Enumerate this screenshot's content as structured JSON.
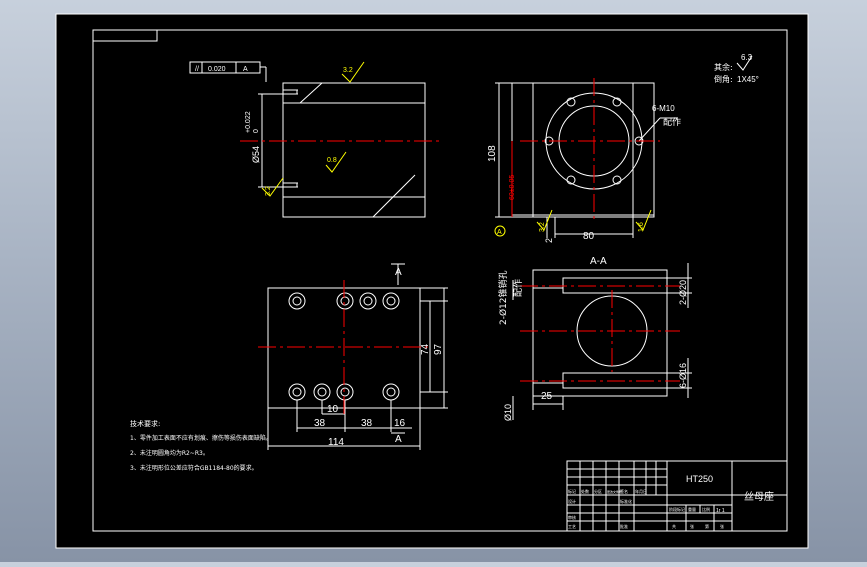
{
  "drawing": {
    "title_block": {
      "material": "HT250",
      "part_name": "丝母座",
      "sheet": "1r 1"
    },
    "roughness_note": {
      "label": "其余:",
      "value": "6.3"
    },
    "chamfer_note": {
      "label": "倒角:",
      "value": "1X45°"
    },
    "front_view": {
      "tolerance_frame": {
        "symbol": "//",
        "value": "0.020",
        "datum": "A"
      },
      "bore_dim": "Ø54",
      "bore_tol_upper": "+0.022",
      "bore_tol_lower": "0",
      "roughness_top": "3.2",
      "roughness_mid": "0.8",
      "roughness_left": "3.2"
    },
    "side_view": {
      "height_dim": "108",
      "center_dim": "60±0.05",
      "screw_note": "6-M10",
      "screw_note_suffix": "配作",
      "dim_bottom": "80",
      "dim_small": "2",
      "datum": "A",
      "roughness_a": "3.2",
      "roughness_b": "1.6"
    },
    "plan_view": {
      "section_mark": "A",
      "dim_top": "10",
      "dim_left": "38",
      "dim_mid": "38",
      "dim_right": "16",
      "dim_total": "114",
      "dim_74": "74",
      "dim_97": "97"
    },
    "section_view": {
      "title": "A-A",
      "pin_note": "2-Ø12锥销孔",
      "pin_note_suffix": "配作",
      "dim_20": "2-Ø20",
      "dim_16": "6-Ø16",
      "dim_10": "Ø10",
      "dim_25": "25"
    },
    "tech_requirements": {
      "title": "技术要求:",
      "items": [
        "1、零件加工表面不应有划痕、擦伤等损伤表面缺陷。",
        "2、未注明圆角均为R2~R3。",
        "3、未注明形位公差应符合GB1184-80的要求。"
      ]
    },
    "title_table": {
      "row_a": [
        "标记",
        "处数",
        "分区",
        "更改文件号",
        "签名",
        "年月日"
      ],
      "row_b": [
        "设计",
        "",
        "",
        "标准化",
        "",
        ""
      ],
      "row_c": [
        "审核",
        "",
        "",
        "",
        "",
        ""
      ],
      "row_d": [
        "工艺",
        "",
        "",
        "批准",
        "",
        ""
      ],
      "stage_labels": [
        "阶段标记",
        "重量",
        "比例"
      ],
      "sheet_labels": [
        "共",
        "张",
        "第",
        "张"
      ]
    }
  },
  "colors": {
    "background": "#000000",
    "frame": "#ffffff",
    "centerline": "#ff0000",
    "annotation": "#ffff00",
    "datum": "#00ffff",
    "window_bg": "#a9b4c4"
  }
}
